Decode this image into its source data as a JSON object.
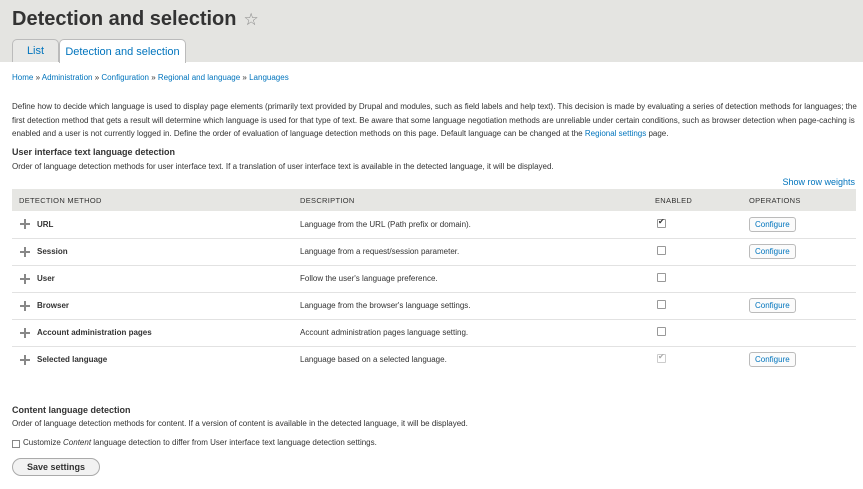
{
  "page_title": "Detection and selection",
  "tabs": [
    {
      "label": "List"
    },
    {
      "label": "Detection and selection"
    }
  ],
  "breadcrumb": [
    "Home",
    "Administration",
    "Configuration",
    "Regional and language",
    "Languages"
  ],
  "intro": {
    "text_before_link": "Define how to decide which language is used to display page elements (primarily text provided by Drupal and modules, such as field labels and help text). This decision is made by evaluating a series of detection methods for languages; the first detection method that gets a result will determine which language is used for that type of text. Be aware that some language negotiation methods are unreliable under certain conditions, such as browser detection when page-caching is enabled and a user is not currently logged in. Define the order of evaluation of language detection methods on this page. Default language can be changed at the ",
    "link": "Regional settings",
    "text_after_link": " page."
  },
  "ui_section": {
    "heading": "User interface text language detection",
    "description": "Order of language detection methods for user interface text. If a translation of user interface text is available in the detected language, it will be displayed.",
    "show_row_weights": "Show row weights"
  },
  "table": {
    "headers": [
      "DETECTION METHOD",
      "DESCRIPTION",
      "ENABLED",
      "OPERATIONS"
    ],
    "rows": [
      {
        "method": "URL",
        "description": "Language from the URL (Path prefix or domain).",
        "enabled": true,
        "disabled": false,
        "operation": "Configure"
      },
      {
        "method": "Session",
        "description": "Language from a request/session parameter.",
        "enabled": false,
        "disabled": false,
        "operation": "Configure"
      },
      {
        "method": "User",
        "description": "Follow the user's language preference.",
        "enabled": false,
        "disabled": false,
        "operation": ""
      },
      {
        "method": "Browser",
        "description": "Language from the browser's language settings.",
        "enabled": false,
        "disabled": false,
        "operation": "Configure"
      },
      {
        "method": "Account administration pages",
        "description": "Account administration pages language setting.",
        "enabled": false,
        "disabled": false,
        "operation": ""
      },
      {
        "method": "Selected language",
        "description": "Language based on a selected language.",
        "enabled": true,
        "disabled": true,
        "operation": "Configure"
      }
    ]
  },
  "content_section": {
    "heading": "Content language detection",
    "description": "Order of language detection methods for content. If a version of content is available in the detected language, it will be displayed.",
    "customize_prefix": "Customize ",
    "customize_em": "Content",
    "customize_suffix": " language detection to differ from User interface text language detection settings."
  },
  "save_button": "Save settings",
  "colors": {
    "link": "#0074bd",
    "header_bg": "#e4e4e1"
  }
}
